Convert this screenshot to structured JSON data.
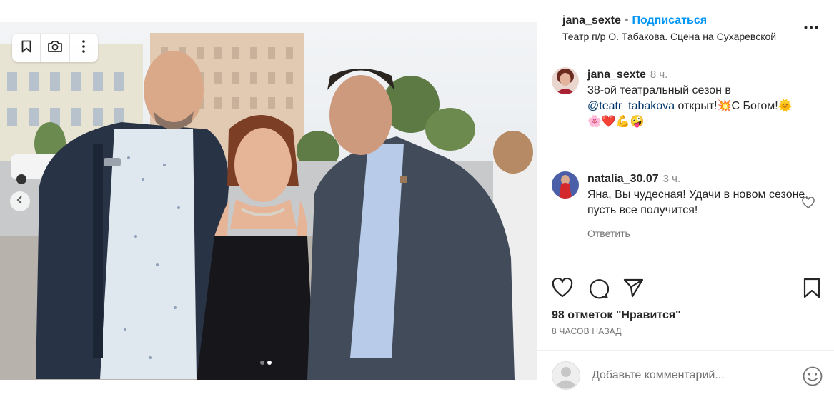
{
  "post": {
    "author": "jana_sexte",
    "separator": "•",
    "follow_label": "Подписаться",
    "location": "Театр п/р О. Табакова. Сцена на Сухаревской"
  },
  "caption": {
    "user": "jana_sexte",
    "time": "8 ч.",
    "text_1": "38-ой театральный сезон в",
    "mention": "@teatr_tabakova",
    "text_2": " открыт!💥С Богом!🌞",
    "text_3": "🌸❤️💪🤪"
  },
  "comment": {
    "user": "natalia_30.07",
    "time": "3 ч.",
    "text": "Яна, Вы чудесная! Удачи в новом сезоне, пусть все получится!",
    "reply_label": "Ответить"
  },
  "actions": {
    "likes": "98 отметок \"Нравится\"",
    "time_ago": "8 ЧАСОВ НАЗАД"
  },
  "add_comment": {
    "placeholder": "Добавьте комментарий..."
  },
  "carousel": {
    "slides": 2,
    "active_slide": 2
  },
  "icons": {
    "toolbar": [
      "bookmark-icon",
      "camera-icon",
      "more-vertical-icon"
    ],
    "actions": [
      "heart-icon",
      "comment-icon",
      "share-icon",
      "save-icon"
    ]
  },
  "colors": {
    "link": "#0095f6",
    "mention": "#00376b",
    "secondary_text": "#737373"
  }
}
